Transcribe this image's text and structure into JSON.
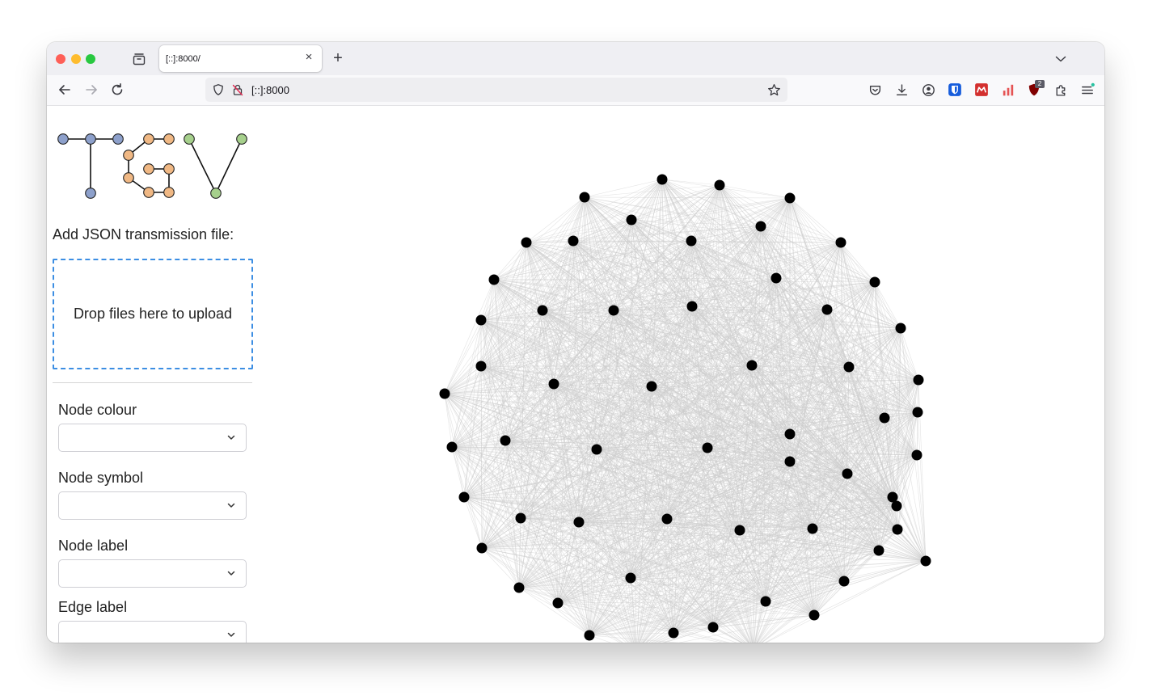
{
  "browser": {
    "tab_title": "[::]:8000/",
    "tab_close": "×",
    "new_tab": "+",
    "url": "[::]:8000",
    "extension_badge": "2"
  },
  "sidebar": {
    "upload_label": "Add JSON transmission file:",
    "dropzone_text": "Drop files here to upload",
    "controls": [
      {
        "label": "Node colour",
        "value": ""
      },
      {
        "label": "Node symbol",
        "value": ""
      },
      {
        "label": "Node label",
        "value": ""
      },
      {
        "label": "Edge label",
        "value": ""
      }
    ]
  },
  "colors": {
    "logo_blue": "#8da0cb",
    "logo_orange": "#f0b884",
    "logo_green": "#a6d08c",
    "edge": "#cccccc",
    "node": "#000000",
    "dropzone_border": "#3c8ee3"
  },
  "graph": {
    "node_count": 59,
    "layout": "dense network, all nodes connected"
  }
}
